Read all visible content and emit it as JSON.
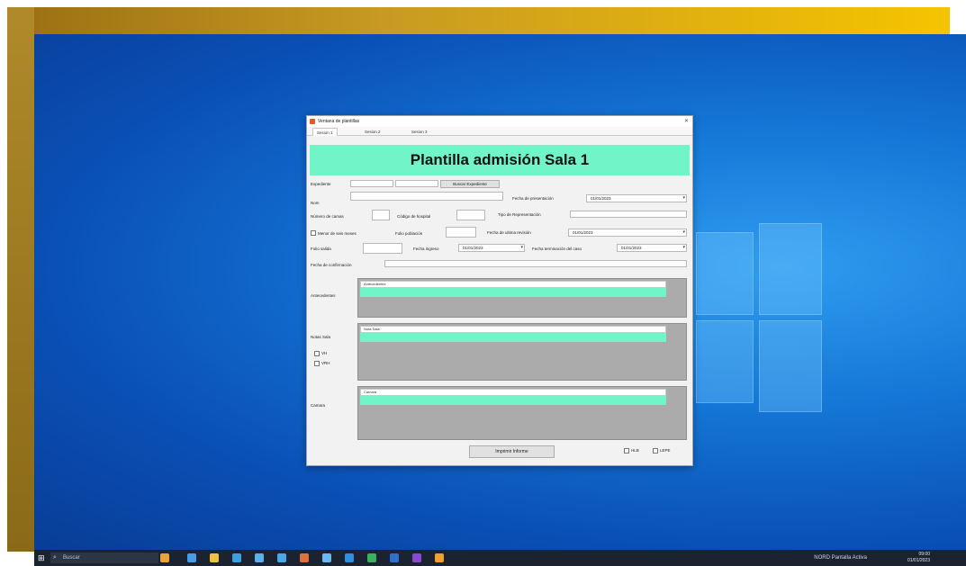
{
  "window": {
    "title": "Ventana de plantillas",
    "tabs": [
      "Sesion 1",
      "Sesion 2",
      "Sesion 3"
    ]
  },
  "header": {
    "title": "Plantilla admisión Sala 1"
  },
  "form": {
    "row1": {
      "label": "Expediente",
      "search_button": "Buscar Expediente"
    },
    "row2": {
      "name_label": "Nom",
      "admission_date_label": "Fecha de presentación",
      "admission_date_value": "01/01/2023"
    },
    "row3": {
      "label_a": "Número de camas",
      "label_b": "Código de hospital",
      "label_c": "Tipo de Representación"
    },
    "row4": {
      "checkbox_label": "Menor de seis meses",
      "label_b": "Folio población",
      "label_c": "Fecha de ultima revisión",
      "date_value": "01/01/2023"
    },
    "row5": {
      "label_a": "Folio salida",
      "label_b": "Fecha ingreso",
      "date_b": "01/01/2023",
      "label_c": "Fecha terminación del caso",
      "date_c": "01/01/2023"
    },
    "row6": {
      "label": "Fecha de confirmación"
    }
  },
  "grids": {
    "antecedentes": {
      "label": "Antecedentes",
      "header": "Antecedentes"
    },
    "notas": {
      "label": "Notas Sala",
      "header": "Nota Sala",
      "check1": "VH",
      "check2": "VRH"
    },
    "camara": {
      "label": "Camara",
      "header": "Camara"
    }
  },
  "footer": {
    "print_button": "Imprimir Informe",
    "check1": "HLB",
    "check2": "LEPE"
  },
  "taskbar": {
    "search_placeholder": "Buscar",
    "tray_text": "NORD Pantalla Activa",
    "clock_time": "09:00",
    "clock_date": "01/01/2023"
  },
  "colors": {
    "accent": "#71f5c8",
    "desktop": "#1476d6",
    "gold": "#f5c400"
  }
}
